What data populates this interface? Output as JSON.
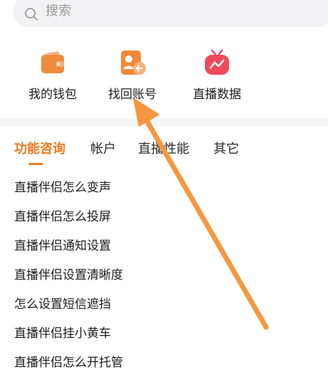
{
  "search": {
    "placeholder": "搜索",
    "icon": "search-icon"
  },
  "quick_actions": [
    {
      "label": "我的钱包",
      "icon": "wallet-icon",
      "color": "#f08a3a"
    },
    {
      "label": "找回账号",
      "icon": "account-recovery-icon",
      "color": "#f08a3a"
    },
    {
      "label": "直播数据",
      "icon": "tv-chart-icon",
      "color": "#f1485c"
    }
  ],
  "tabs": [
    {
      "label": "功能咨询",
      "active": true
    },
    {
      "label": "帐户",
      "active": false
    },
    {
      "label": "直播性能",
      "active": false
    },
    {
      "label": "其它",
      "active": false
    }
  ],
  "faq_items": [
    "直播伴侣怎么变声",
    "直播伴侣怎么投屏",
    "直播伴侣通知设置",
    "直播伴侣设置清晰度",
    "怎么设置短信遮挡",
    "直播伴侣挂小黄车",
    "直播伴侣怎么开托管"
  ],
  "colors": {
    "accent": "#ee7a1e",
    "annotation_arrow": "#f7973f"
  }
}
